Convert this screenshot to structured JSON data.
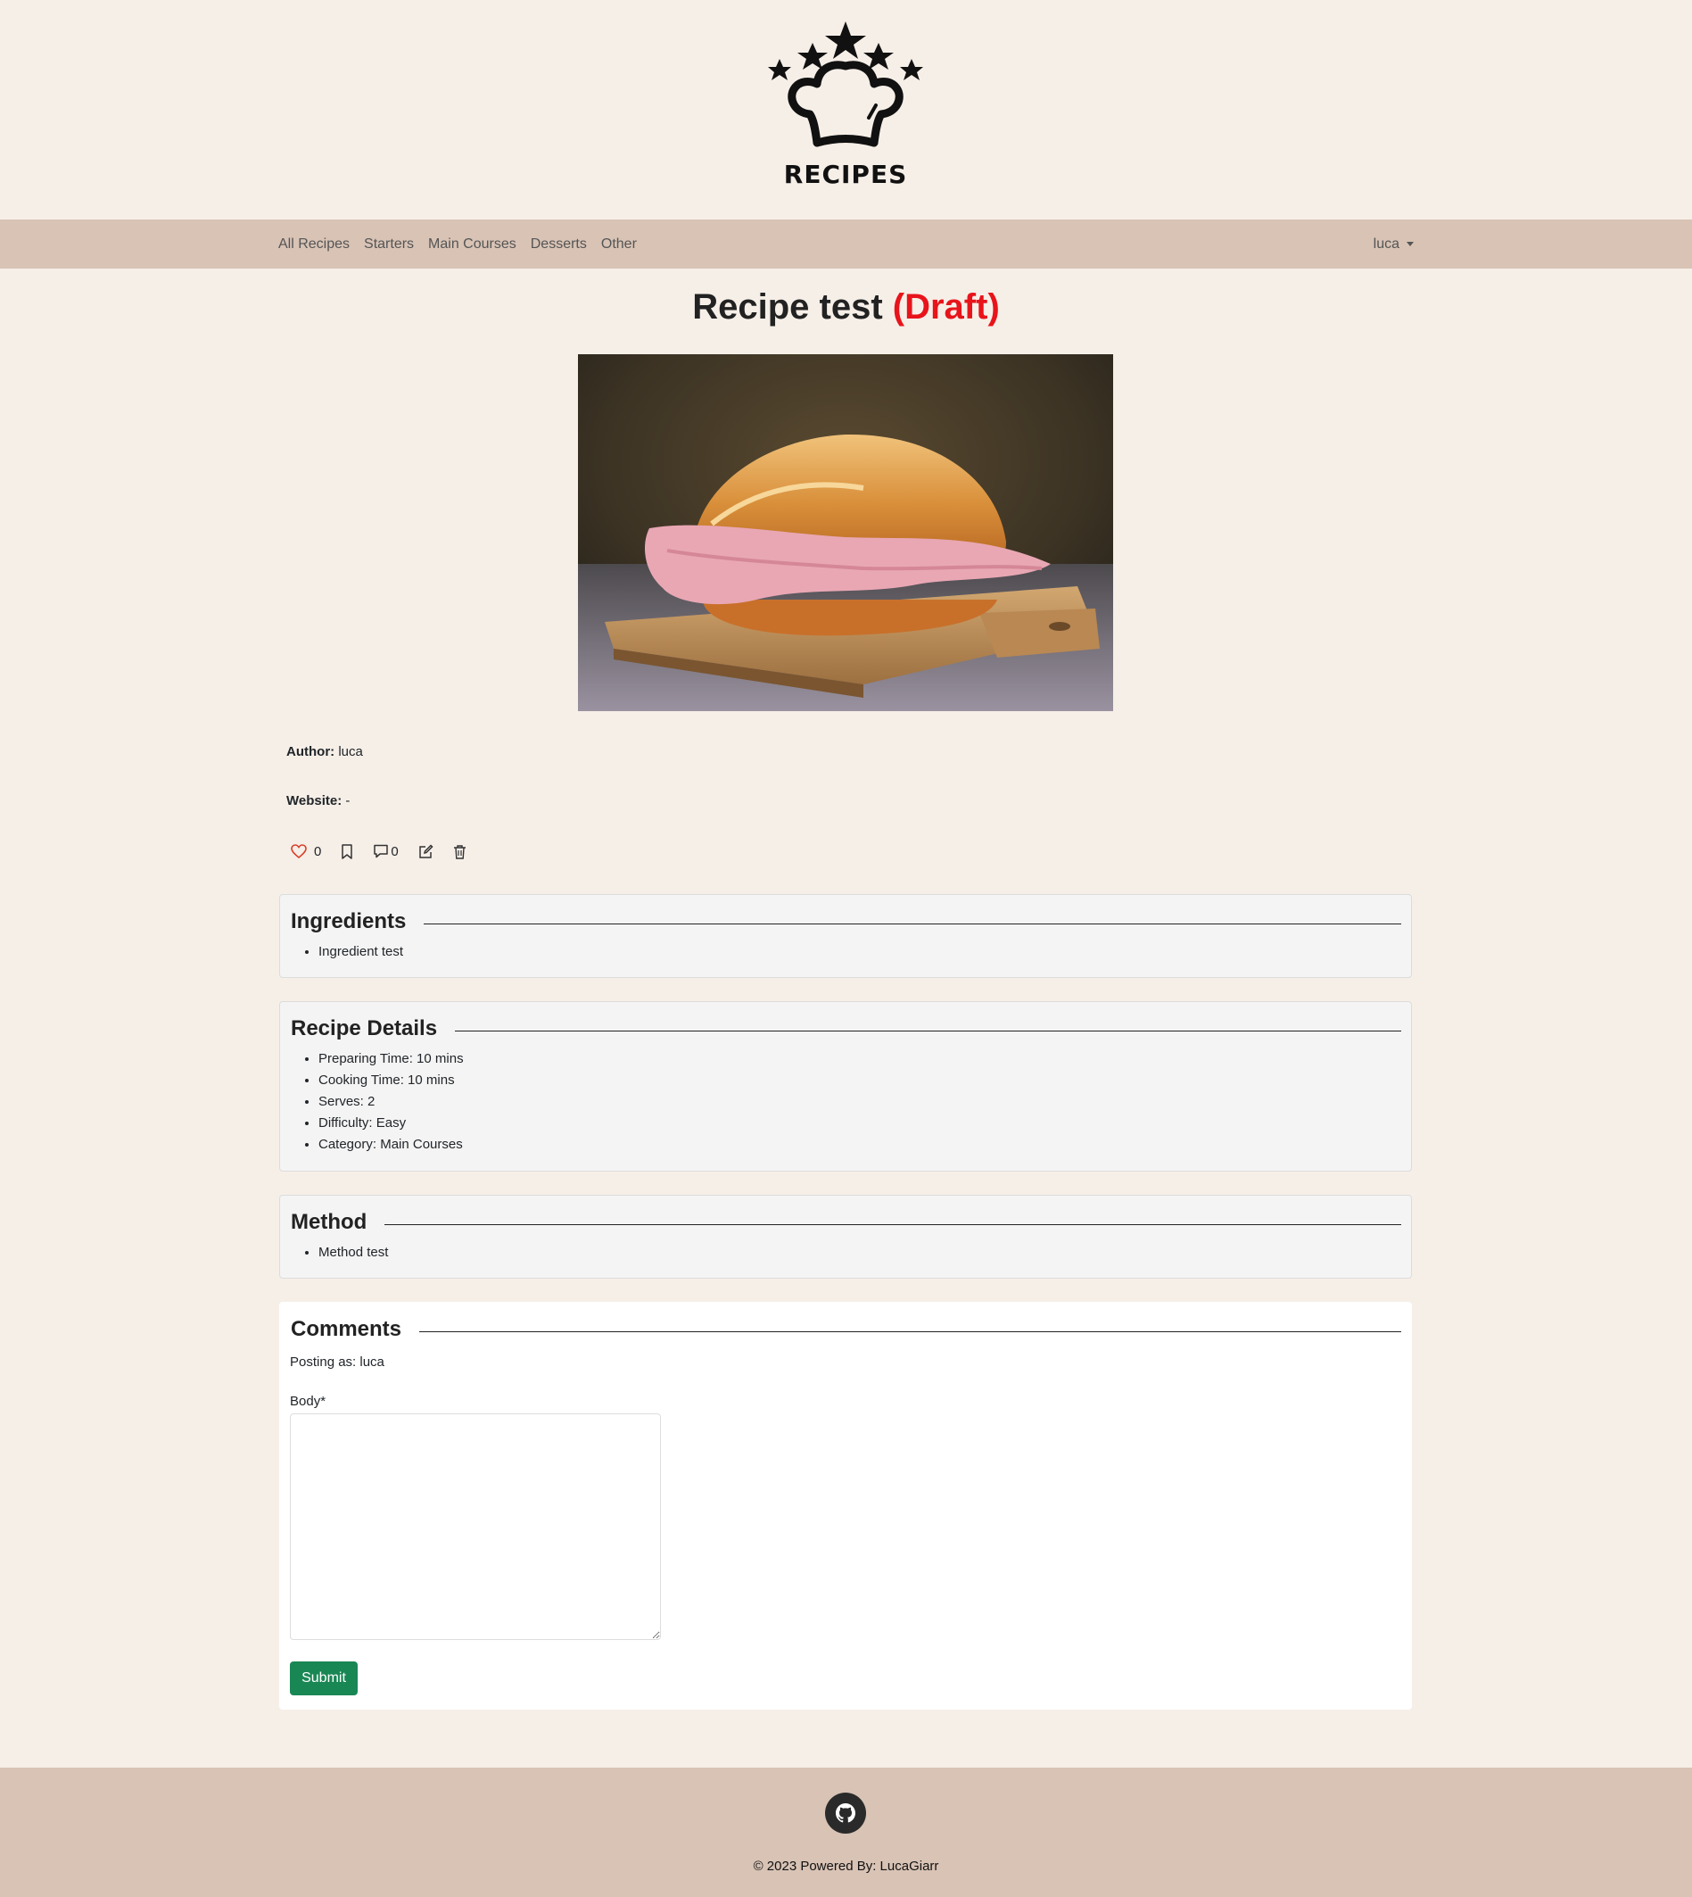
{
  "brand": {
    "logo_text": "RECIPES"
  },
  "nav": {
    "links": [
      "All Recipes",
      "Starters",
      "Main Courses",
      "Desserts",
      "Other"
    ],
    "user": "luca"
  },
  "recipe": {
    "title": "Recipe test",
    "status": "(Draft)",
    "author_label": "Author:",
    "author": "luca",
    "website_label": "Website:",
    "website": "-",
    "likes": "0",
    "comments_count": "0"
  },
  "ingredients": {
    "heading": "Ingredients",
    "items": [
      "Ingredient test"
    ]
  },
  "details": {
    "heading": "Recipe Details",
    "items": [
      "Preparing Time: 10 mins",
      "Cooking Time: 10 mins",
      "Serves: 2",
      "Difficulty: Easy",
      "Category: Main Courses"
    ]
  },
  "method": {
    "heading": "Method",
    "items": [
      "Method test"
    ]
  },
  "comments": {
    "heading": "Comments",
    "posting_as": "Posting as: luca",
    "body_label": "Body*",
    "submit_label": "Submit"
  },
  "footer": {
    "copyright": "© 2023 Powered By: LucaGiarr"
  },
  "colors": {
    "navbar": "#d8c3b5",
    "page_bg": "#f6efe8",
    "draft": "#e8141b",
    "submit": "#198754",
    "heart": "#d9412b"
  }
}
